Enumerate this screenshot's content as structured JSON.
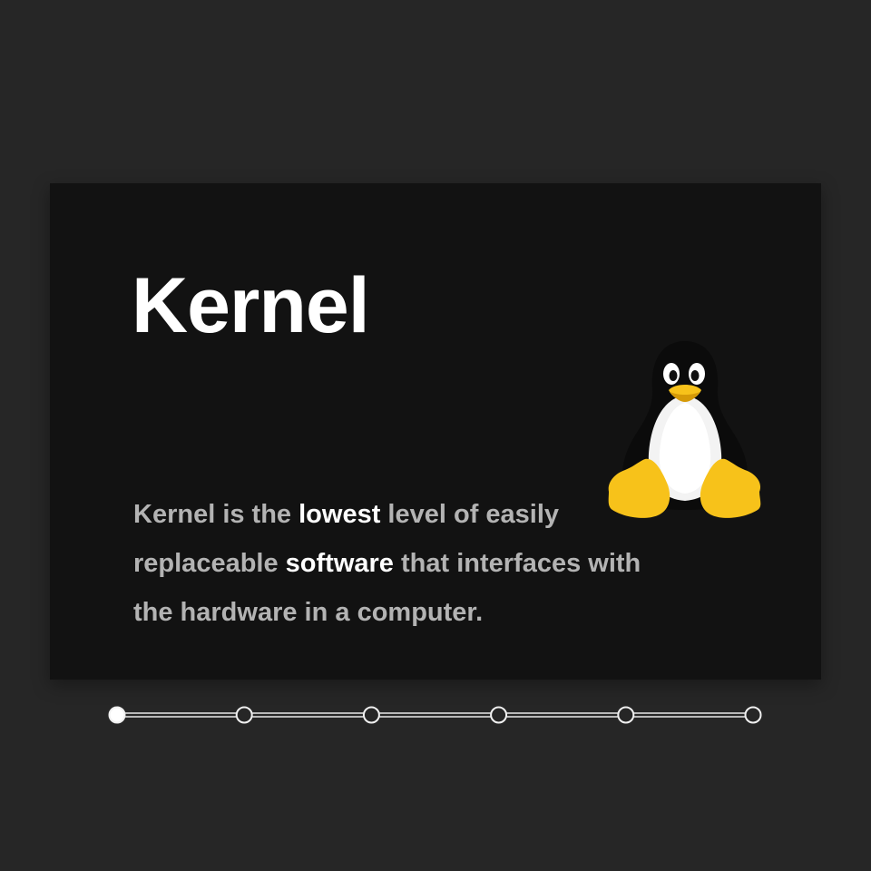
{
  "slide": {
    "title": "Kernel",
    "description_parts": [
      "Kernel is the ",
      "lowest",
      " level of easily replaceable ",
      "software",
      " that interfaces with the hardware in a computer."
    ],
    "emphasized_words": [
      "lowest",
      "software"
    ],
    "mascot_icon": "linux-tux-penguin-icon"
  },
  "progress": {
    "total_steps": 6,
    "current_step": 1
  },
  "colors": {
    "background": "#262626",
    "card": "#121212",
    "title": "#ffffff",
    "body_text": "#b3b3b3",
    "emphasis": "#ffffff",
    "tux_yellow": "#f7c21a"
  }
}
